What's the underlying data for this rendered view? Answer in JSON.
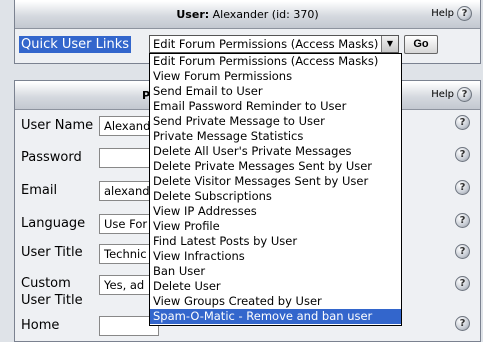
{
  "header": {
    "user_label": "User:",
    "user_value": "Alexander (id: 370)",
    "help_label": "Help"
  },
  "quick_links": {
    "label": "Quick User Links",
    "selected": "Edit Forum Permissions (Access Masks)",
    "go_label": "Go",
    "options": [
      "Edit Forum Permissions (Access Masks)",
      "View Forum Permissions",
      "Send Email to User",
      "Email Password Reminder to User",
      "Send Private Message to User",
      "Private Message Statistics",
      "Delete All User's Private Messages",
      "Delete Private Messages Sent by User",
      "Delete Visitor Messages Sent by User",
      "Delete Subscriptions",
      "View IP Addresses",
      "View Profile",
      "Find Latest Posts by User",
      "View Infractions",
      "Ban User",
      "Delete User",
      "View Groups Created by User",
      "Spam-O-Matic - Remove and ban user"
    ],
    "highlighted_index": 17
  },
  "profile_panel": {
    "title_fragment": "P",
    "help_label": "Help",
    "fields": [
      {
        "label": "User Name",
        "value": "Alexand"
      },
      {
        "label": "Password",
        "value": ""
      },
      {
        "label": "Email",
        "value": "alexand"
      },
      {
        "label": "Language",
        "value": "Use For"
      },
      {
        "label": "User Title",
        "value": "Technic"
      },
      {
        "label": "Custom",
        "label2": "User Title",
        "value": "Yes, ad"
      },
      {
        "label": "Home",
        "value": ""
      }
    ]
  },
  "colors": {
    "highlight": "#3366cc",
    "background": "#dfe3e8"
  }
}
